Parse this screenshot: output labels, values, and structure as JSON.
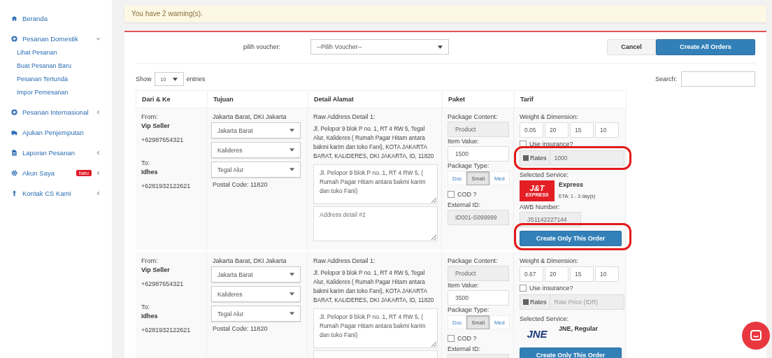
{
  "sidebar": {
    "items": [
      {
        "label": "Beranda"
      },
      {
        "label": "Pesanan Domestik",
        "expanded": true,
        "children": [
          {
            "label": "Lihat Pesanan"
          },
          {
            "label": "Buat Pesanan Baru"
          },
          {
            "label": "Pesanan Tertunda"
          },
          {
            "label": "Impor Pemesanan"
          }
        ]
      },
      {
        "label": "Pesanan Internasional",
        "expanded": false
      },
      {
        "label": "Ajukan Penjemputan"
      },
      {
        "label": "Laporan Pesanan",
        "expanded": false
      },
      {
        "label": "Akun Saya",
        "expanded": false,
        "badge": "baru"
      },
      {
        "label": "Kontak CS Kami",
        "expanded": false
      }
    ]
  },
  "alert": {
    "text": "You have 2 warning(s)."
  },
  "voucher": {
    "label": "pilih voucher:",
    "placeholder": "--Pilih Voucher--"
  },
  "buttons": {
    "cancel": "Cancel",
    "create_all": "Create All Orders"
  },
  "table_controls": {
    "show": "Show",
    "page_size": "10",
    "entries": "entries",
    "search_label": "Search:"
  },
  "table": {
    "columns": [
      "Dari & Ke",
      "Tujuan",
      "Detail Alamat",
      "Paket",
      "Tarif"
    ],
    "rows": [
      {
        "from_label": "From:",
        "from_name": "Vip Seller",
        "from_phone": "+62987654321",
        "to_label": "To:",
        "to_name": "Idhes",
        "to_phone": "+6281932122621",
        "region": "Jakarta Barat, DKI Jakarta",
        "selects": [
          "Jakarta Barat",
          "Kalideres",
          "Tegal Alur"
        ],
        "postal": "Postal Code: 11820",
        "raw_label": "Raw Address Detail 1:",
        "raw_address": "Jl. Pelopor 9 blok P no. 1, RT 4 RW 5, Tegal Alur, Kalideres ( Rumah Pagar Hitam antara bakmi karim dan toko Fani), KOTA JAKARTA BARAT, KALIDERES, DKI JAKARTA, ID, 11820",
        "address_value": "Jl. Pelopor 9 blok P no. 1, RT 4 RW 5, ( Rumah Pagar Hitam antara bakmi karim dan toko Fani)",
        "address2_placeholder": "Address detail #2",
        "content_label": "Package Content:",
        "content_value": "Product",
        "item_value_label": "Item Value:",
        "item_value": "1500",
        "type_label": "Package Type:",
        "types": [
          {
            "label": "Doc",
            "selected": false
          },
          {
            "label": "Small",
            "selected": true
          },
          {
            "label": "Med",
            "selected": false
          }
        ],
        "cod": {
          "label": "COD ?",
          "checked": false
        },
        "external_label": "External ID:",
        "external_value": "ID001-S099999",
        "wd_label": "Weight & Dimension:",
        "dims": [
          "0.05",
          "20",
          "15",
          "10"
        ],
        "insurance": {
          "label": "Use insurance?",
          "checked": false
        },
        "rates": {
          "label": "Rates",
          "value": "1000",
          "highlighted": true
        },
        "service_label": "Selected Service:",
        "logo": {
          "kind": "jnt",
          "text": "J&T",
          "subtext": "EXPRESS"
        },
        "service_name": "Express",
        "eta": "ETA: 1 - 3 day(s)",
        "awb_label": "AWB Number:",
        "awb_value": "JS1142227144",
        "button": {
          "label": "Create Only This Order",
          "highlighted": true
        }
      },
      {
        "from_label": "From:",
        "from_name": "Vip Seller",
        "from_phone": "+62987654321",
        "to_label": "To:",
        "to_name": "Idhes",
        "to_phone": "+6281932122621",
        "region": "Jakarta Barat, DKI Jakarta",
        "selects": [
          "Jakarta Barat",
          "Kalideres",
          "Tegal Alur"
        ],
        "postal": "Postal Code: 11820",
        "raw_label": "Raw Address Detail 1:",
        "raw_address": "Jl. Pelopor 9 blok P no. 1, RT 4 RW 5, Tegal Alur, Kalideres ( Rumah Pagar Hitam antara bakmi karim dan toko Fani), KOTA JAKARTA BARAT, KALIDERES, DKI JAKARTA, ID, 11820",
        "address_value": "Jl. Pelopor 9 blok P no. 1, RT 4 RW 5, ( Rumah Pagar Hitam antara bakmi karim dan toko Fani)",
        "content_label": "Package Content:",
        "content_value": "Product",
        "item_value_label": "Item Value:",
        "item_value": "3500",
        "type_label": "Package Type:",
        "types": [
          {
            "label": "Doc",
            "selected": false
          },
          {
            "label": "Small",
            "selected": true
          },
          {
            "label": "Med",
            "selected": false
          }
        ],
        "cod": {
          "label": "COD ?",
          "checked": false
        },
        "external_label": "External ID:",
        "wd_label": "Weight & Dimension:",
        "dims": [
          "0.67",
          "20",
          "15",
          "10"
        ],
        "insurance": {
          "label": "Use insurance?",
          "checked": false
        },
        "rates": {
          "label": "Rates",
          "placeholder": "Rate Price (IDR)",
          "highlighted": false
        },
        "service_label": "Selected Service:",
        "logo": {
          "kind": "jne",
          "text": "JNE"
        },
        "service_name": "JNE, Regular",
        "button": {
          "label": "Create Only This Order",
          "highlighted": false
        }
      }
    ]
  }
}
